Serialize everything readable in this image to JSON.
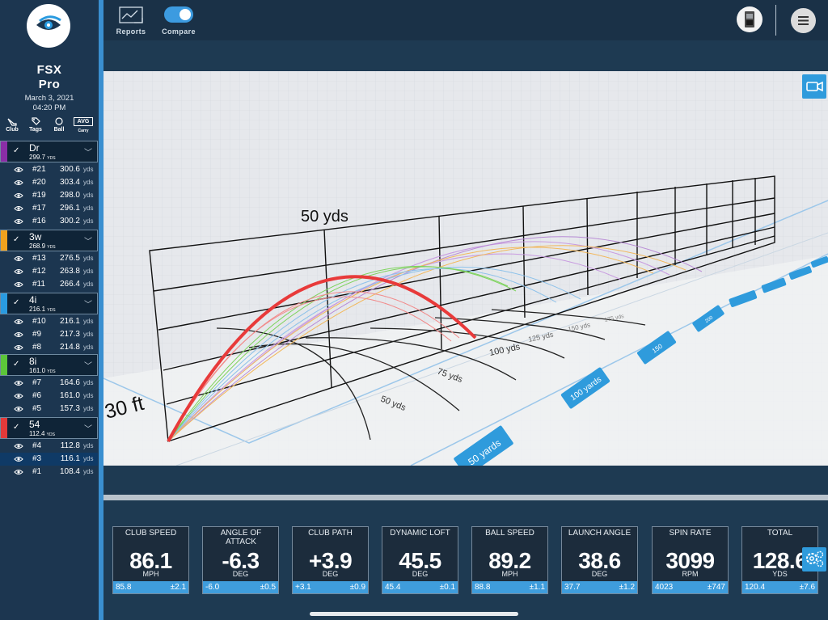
{
  "app": {
    "name_line1": "FSX",
    "name_line2": "Pro",
    "date": "March 3, 2021",
    "time": "04:20 PM"
  },
  "filters": [
    {
      "label": "Club",
      "icon": "club-icon"
    },
    {
      "label": "Tags",
      "icon": "tag-icon"
    },
    {
      "label": "Ball",
      "icon": "ball-icon"
    },
    {
      "label": "Carry",
      "icon": "avg-badge",
      "badge": "AVG"
    }
  ],
  "groups": [
    {
      "name": "Dr",
      "avg": "299.7",
      "unit": "YDS",
      "color": "#8a2ea6",
      "shots": [
        {
          "num": "#21",
          "dist": "300.6"
        },
        {
          "num": "#20",
          "dist": "303.4"
        },
        {
          "num": "#19",
          "dist": "298.0"
        },
        {
          "num": "#17",
          "dist": "296.1"
        },
        {
          "num": "#16",
          "dist": "300.2"
        }
      ]
    },
    {
      "name": "3w",
      "avg": "268.9",
      "unit": "YDS",
      "color": "#f0a21e",
      "shots": [
        {
          "num": "#13",
          "dist": "276.5"
        },
        {
          "num": "#12",
          "dist": "263.8"
        },
        {
          "num": "#11",
          "dist": "266.4"
        }
      ]
    },
    {
      "name": "4i",
      "avg": "216.1",
      "unit": "YDS",
      "color": "#2a9be0",
      "shots": [
        {
          "num": "#10",
          "dist": "216.1"
        },
        {
          "num": "#9",
          "dist": "217.3"
        },
        {
          "num": "#8",
          "dist": "214.8"
        }
      ]
    },
    {
      "name": "8i",
      "avg": "161.0",
      "unit": "YDS",
      "color": "#5cc63a",
      "shots": [
        {
          "num": "#7",
          "dist": "164.6"
        },
        {
          "num": "#6",
          "dist": "161.0"
        },
        {
          "num": "#5",
          "dist": "157.3"
        }
      ]
    },
    {
      "name": "54",
      "avg": "112.4",
      "unit": "YDS",
      "color": "#e23a3a",
      "shots": [
        {
          "num": "#4",
          "dist": "112.8"
        },
        {
          "num": "#3",
          "dist": "116.1",
          "selected": true
        },
        {
          "num": "#1",
          "dist": "108.4"
        }
      ]
    }
  ],
  "yds_unit": "yds",
  "topbar": {
    "reports": "Reports",
    "compare": "Compare",
    "compare_on": true
  },
  "view": {
    "height_label": "30 ft",
    "distance_label": "50 yds",
    "arc_labels": [
      "50 yds",
      "75 yds",
      "100 yds",
      "125 yds",
      "150 yds",
      "175 yds"
    ],
    "yard_markers": [
      "50 yards",
      "100 yards",
      "150",
      "200"
    ]
  },
  "stats": [
    {
      "label": "CLUB SPEED",
      "value": "86.1",
      "unit": "MPH",
      "avg": "85.8",
      "sd": "±2.1"
    },
    {
      "label": "ANGLE OF ATTACK",
      "value": "-6.3",
      "unit": "DEG",
      "avg": "-6.0",
      "sd": "±0.5"
    },
    {
      "label": "CLUB PATH",
      "value": "+3.9",
      "unit": "DEG",
      "avg": "+3.1",
      "sd": "±0.9"
    },
    {
      "label": "DYNAMIC LOFT",
      "value": "45.5",
      "unit": "DEG",
      "avg": "45.4",
      "sd": "±0.1"
    },
    {
      "label": "BALL SPEED",
      "value": "89.2",
      "unit": "MPH",
      "avg": "88.8",
      "sd": "±1.1"
    },
    {
      "label": "LAUNCH ANGLE",
      "value": "38.6",
      "unit": "DEG",
      "avg": "37.7",
      "sd": "±1.2"
    },
    {
      "label": "SPIN RATE",
      "value": "3099",
      "unit": "RPM",
      "avg": "4023",
      "sd": "±747"
    },
    {
      "label": "TOTAL",
      "value": "128.6",
      "unit": "YDS",
      "avg": "120.4",
      "sd": "±7.6"
    }
  ]
}
